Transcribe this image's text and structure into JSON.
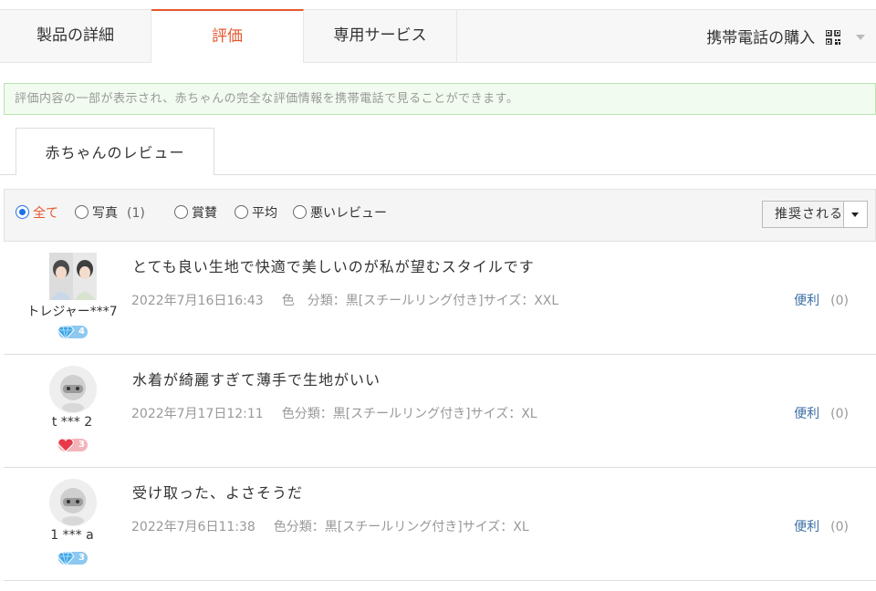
{
  "tabs": [
    {
      "label": "製品の詳細"
    },
    {
      "label": "評価"
    },
    {
      "label": "専用サービス"
    }
  ],
  "mobile_buy": "携帯電話の購入",
  "notice": "評価内容の一部が表示され、赤ちゃんの完全な評価情報を携帯電話で見ることができます。",
  "subtab": "赤ちゃんのレビュー",
  "filters": [
    {
      "label": "全て",
      "selected": true,
      "count": ""
    },
    {
      "label": "写真",
      "selected": false,
      "count": "(1)"
    },
    {
      "label": "賞賛",
      "selected": false,
      "count": ""
    },
    {
      "label": "平均",
      "selected": false,
      "count": ""
    },
    {
      "label": "悪いレビュー",
      "selected": false,
      "count": ""
    }
  ],
  "sort": {
    "label": "推奨される"
  },
  "useful_label": "便利",
  "reviews": [
    {
      "user": "トレジャー***7",
      "badge": "4",
      "text": "とても良い生地で快適で美しいのが私が望むスタイルです",
      "date": "2022年7月16日16:43",
      "sku": "色　分類：黒[スチールリング付き]サイズ：XXL",
      "useful_count": "(0)"
    },
    {
      "user": "t *** 2",
      "badge": "3",
      "text": "水着が綺麗すぎて薄手で生地がいい",
      "date": "2022年7月17日12:11",
      "sku": "色分類：黒[スチールリング付き]サイズ：XL",
      "useful_count": "(0)"
    },
    {
      "user": "1 *** a",
      "badge": "3",
      "text": "受け取った、よさそうだ",
      "date": "2022年7月6日11:38",
      "sku": "色分類：黒[スチールリング付き]サイズ：XL",
      "useful_count": "(0)"
    }
  ],
  "colors": {
    "accent": "#e4572e",
    "link": "#3a6ea5",
    "radio": "#1a73e8"
  }
}
